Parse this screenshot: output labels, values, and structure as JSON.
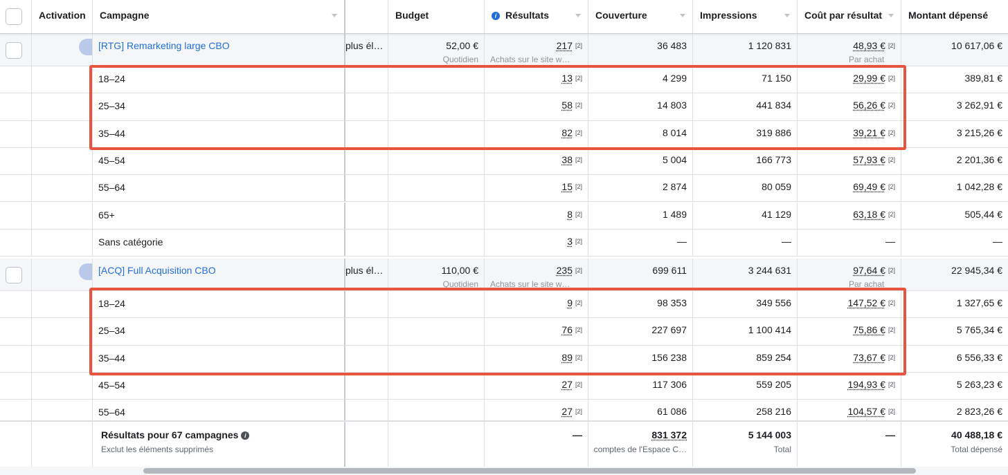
{
  "headers": {
    "activation": "Activation",
    "campaign": "Campagne",
    "budget": "Budget",
    "results": "Résultats",
    "reach": "Couverture",
    "impressions": "Impressions",
    "cost": "Coût par résultat",
    "spent": "Montant dépensé"
  },
  "campaigns": [
    {
      "name": "[RTG] Remarketing large CBO",
      "partial": "plus él…",
      "budget": "52,00 €",
      "budget_sub": "Quotidien",
      "results": "217",
      "results_sub": "Achats sur le site w…",
      "reach": "36 483",
      "impressions": "1 120 831",
      "cost": "48,93 €",
      "cost_sub": "Par achat",
      "spent": "10 617,06 €",
      "breakdown": [
        {
          "age": "18–24",
          "results": "13",
          "reach": "4 299",
          "impressions": "71 150",
          "cost": "29,99 €",
          "spent": "389,81 €"
        },
        {
          "age": "25–34",
          "results": "58",
          "reach": "14 803",
          "impressions": "441 834",
          "cost": "56,26 €",
          "spent": "3 262,91 €"
        },
        {
          "age": "35–44",
          "results": "82",
          "reach": "8 014",
          "impressions": "319 886",
          "cost": "39,21 €",
          "spent": "3 215,26 €"
        },
        {
          "age": "45–54",
          "results": "38",
          "reach": "5 004",
          "impressions": "166 773",
          "cost": "57,93 €",
          "spent": "2 201,36 €"
        },
        {
          "age": "55–64",
          "results": "15",
          "reach": "2 874",
          "impressions": "80 059",
          "cost": "69,49 €",
          "spent": "1 042,28 €"
        },
        {
          "age": "65+",
          "results": "8",
          "reach": "1 489",
          "impressions": "41 129",
          "cost": "63,18 €",
          "spent": "505,44 €"
        },
        {
          "age": "Sans catégorie",
          "results": "3",
          "reach": "—",
          "impressions": "—",
          "cost": "—",
          "spent": "—"
        }
      ]
    },
    {
      "name": "[ACQ] Full Acquisition CBO",
      "partial": "plus él…",
      "budget": "110,00 €",
      "budget_sub": "Quotidien",
      "results": "235",
      "results_sub": "Achats sur le site w…",
      "reach": "699 611",
      "impressions": "3 244 631",
      "cost": "97,64 €",
      "cost_sub": "Par achat",
      "spent": "22 945,34 €",
      "breakdown": [
        {
          "age": "18–24",
          "results": "9",
          "reach": "98 353",
          "impressions": "349 556",
          "cost": "147,52 €",
          "spent": "1 327,65 €"
        },
        {
          "age": "25–34",
          "results": "76",
          "reach": "227 697",
          "impressions": "1 100 414",
          "cost": "75,86 €",
          "spent": "5 765,34 €"
        },
        {
          "age": "35–44",
          "results": "89",
          "reach": "156 238",
          "impressions": "859 254",
          "cost": "73,67 €",
          "spent": "6 556,33 €"
        },
        {
          "age": "45–54",
          "results": "27",
          "reach": "117 306",
          "impressions": "559 205",
          "cost": "194,93 €",
          "spent": "5 263,23 €"
        },
        {
          "age": "55–64",
          "results": "27",
          "reach": "61 086",
          "impressions": "258 216",
          "cost": "104,57 €",
          "spent": "2 823,26 €"
        }
      ]
    }
  ],
  "sup_label": "[2]",
  "footer": {
    "title": "Résultats pour 67 campagnes",
    "subtitle": "Exclut les éléments supprimés",
    "results": "—",
    "reach": "831 372",
    "reach_sub": "comptes de l'Espace C…",
    "impressions": "5 144 003",
    "impressions_sub": "Total",
    "cost": "—",
    "spent": "40 488,18 €",
    "spent_sub": "Total dépensé"
  },
  "colors": {
    "highlight": "#e8553e",
    "link": "#216fdb"
  },
  "icons": {
    "info": "info-icon",
    "sort": "sort-caret-icon",
    "dropdown": "dropdown-arrow-icon"
  }
}
